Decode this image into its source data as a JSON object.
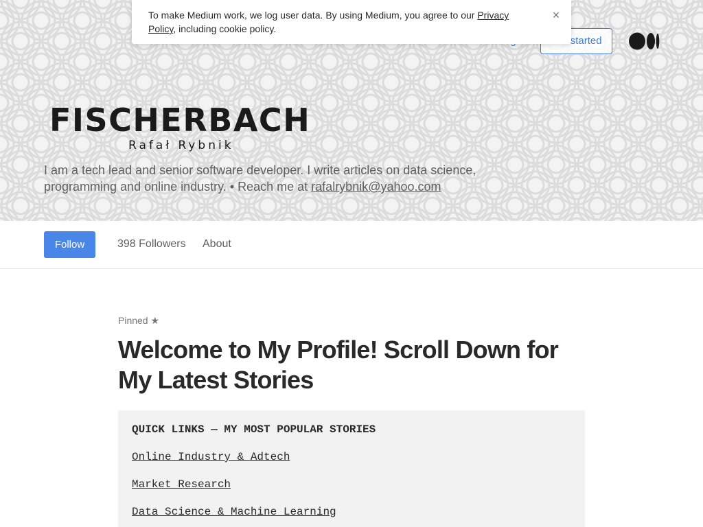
{
  "cookie_banner": {
    "text_before": "To make Medium work, we log user data. By using Medium, you agree to our ",
    "privacy_link": "Privacy Policy",
    "text_after": ", including cookie policy.",
    "close_label": "×"
  },
  "nav": {
    "sign_in": "Sign In",
    "get_started": "Get started"
  },
  "profile": {
    "brand_title": "FISCHERBACH",
    "brand_subtitle": "Rafał Rybnik",
    "bio_text": "I am a tech lead and senior software developer. I write articles on data science, programming and online industry. • Reach me at ",
    "bio_email": "rafalrybnik@yahoo.com",
    "follow_label": "Follow",
    "followers_label": "398 Followers",
    "about_label": "About"
  },
  "post": {
    "pinned_label": "Pinned ★",
    "title": "Welcome to My Profile! Scroll Down for My Latest Stories",
    "links_heading": "QUICK LINKS — MY MOST POPULAR STORIES",
    "links": [
      "Online Industry & Adtech",
      "Market Research",
      "Data Science & Machine Learning"
    ]
  },
  "colors": {
    "accent": "#4a86e8",
    "link_blue": "#3e7bd7",
    "hero_bg": "#f3f3f3"
  }
}
